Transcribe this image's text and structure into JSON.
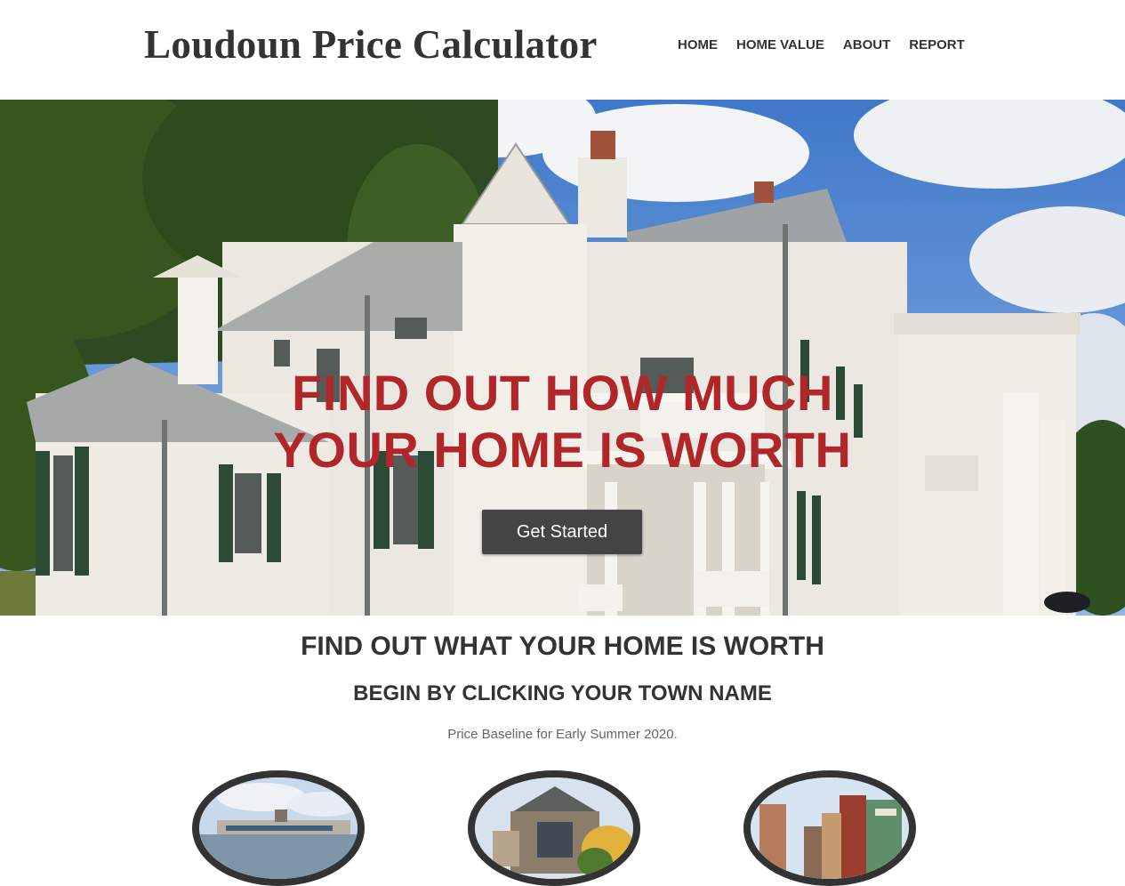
{
  "header": {
    "site_title": "Loudoun Price Calculator",
    "nav": [
      "HOME",
      "HOME VALUE",
      "ABOUT",
      "REPORT"
    ]
  },
  "hero": {
    "headline_line1": "FIND OUT HOW MUCH",
    "headline_line2": "YOUR HOME IS WORTH",
    "cta_label": "Get Started",
    "headline_color": "#b0262b"
  },
  "main": {
    "heading": "FIND OUT WHAT YOUR HOME IS WORTH",
    "subheading": "BEGIN BY CLICKING YOUR TOWN NAME",
    "baseline_note": "Price Baseline for Early Summer 2020."
  }
}
